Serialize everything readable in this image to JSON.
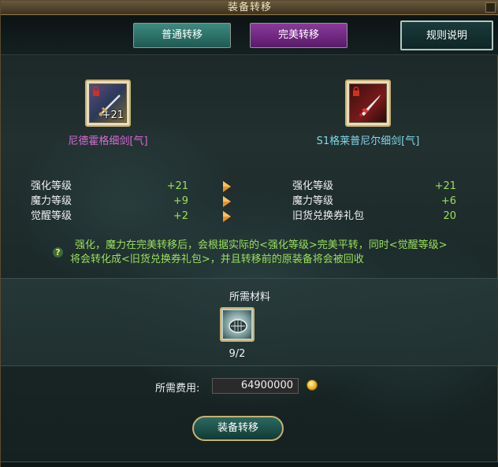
{
  "window": {
    "title": "装备转移"
  },
  "tabs": [
    {
      "label": "普通转移",
      "color": "#2e7a70"
    },
    {
      "label": "完美转移",
      "color": "#7a2a8a"
    },
    {
      "label": "规则说明"
    }
  ],
  "source_item": {
    "name": "尼德霍格细剑[气]",
    "enhancement_badge": "+21",
    "name_color": "#d86ad8"
  },
  "target_item": {
    "name": "S1格莱普尼尔细剑[气]",
    "name_color": "#80d8e8"
  },
  "source_stats": [
    {
      "label": "强化等级",
      "value": "+21"
    },
    {
      "label": "魔力等级",
      "value": "+9"
    },
    {
      "label": "觉醒等级",
      "value": "+2"
    }
  ],
  "target_stats": [
    {
      "label": "强化等级",
      "value": "+21"
    },
    {
      "label": "魔力等级",
      "value": "+6"
    },
    {
      "label": "旧货兑换券礼包",
      "value": "20"
    }
  ],
  "info": {
    "line1": "强化，魔力在完美转移后，会根据实际的<强化等级>完美平转，同时<觉醒等级>",
    "line2": "将会转化成<旧货兑换券礼包>，并且转移前的原装备将会被回收",
    "icon_glyph": "?"
  },
  "materials": {
    "title": "所需材料",
    "count": "9/2"
  },
  "fee": {
    "label": "所需费用:",
    "value": "64900000"
  },
  "transfer_button": {
    "label": "装备转移"
  },
  "colors": {
    "value_green": "#9ae05a",
    "gold_border": "#c8b070"
  }
}
